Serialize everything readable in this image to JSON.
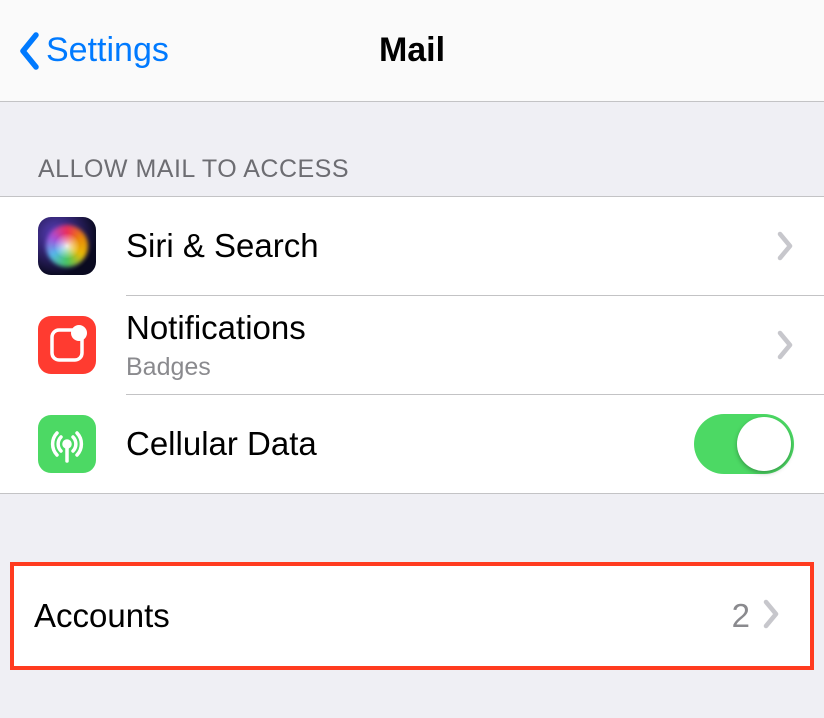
{
  "navbar": {
    "back_label": "Settings",
    "title": "Mail"
  },
  "section_allow": {
    "header": "ALLOW MAIL TO ACCESS",
    "siri_label": "Siri & Search",
    "notifications_label": "Notifications",
    "notifications_sublabel": "Badges",
    "cellular_label": "Cellular Data",
    "cellular_on": true
  },
  "section_accounts": {
    "label": "Accounts",
    "value": "2"
  },
  "colors": {
    "link": "#007aff",
    "highlight": "#ff3b20",
    "toggle_on": "#4cd964"
  }
}
